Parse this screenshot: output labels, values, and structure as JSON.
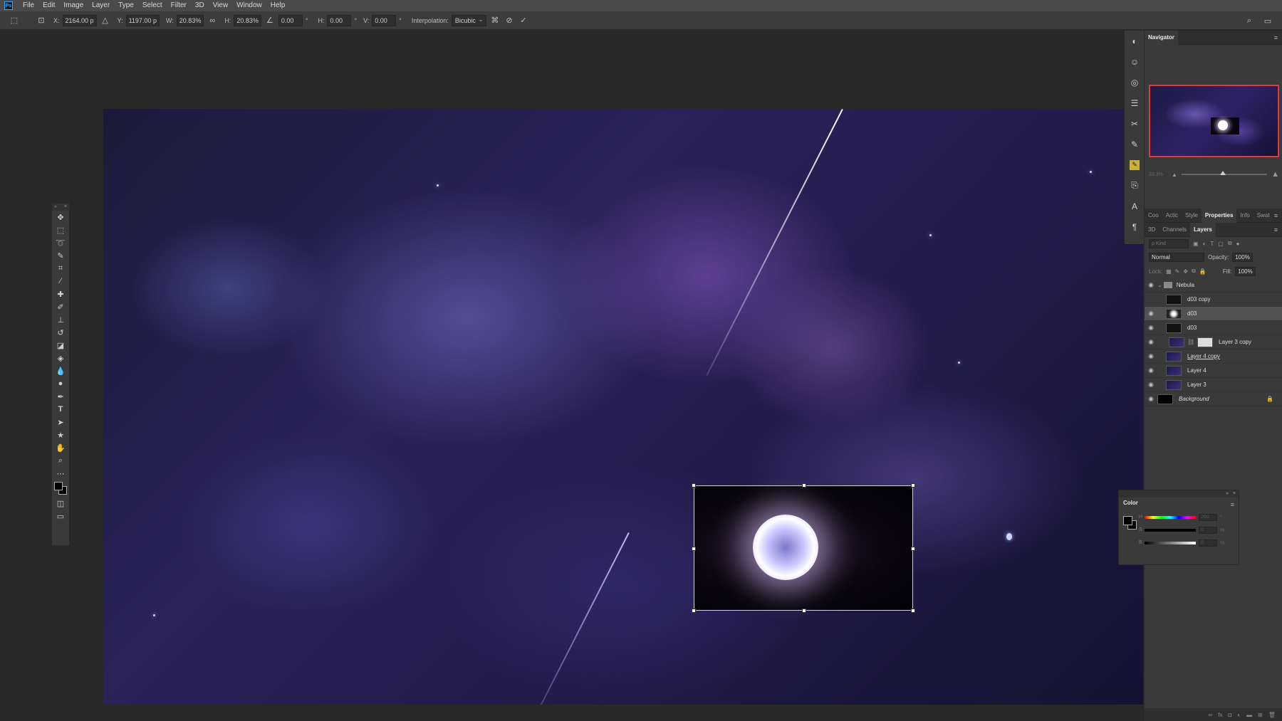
{
  "menubar": {
    "items": [
      "File",
      "Edit",
      "Image",
      "Layer",
      "Type",
      "Select",
      "Filter",
      "3D",
      "View",
      "Window",
      "Help"
    ]
  },
  "options": {
    "x_label": "X:",
    "x_value": "2164.00 p",
    "y_label": "Y:",
    "y_value": "1197.00 p",
    "w_label": "W:",
    "w_value": "20.83%",
    "h_label": "H:",
    "h_value": "20.83%",
    "angle_value": "0.00",
    "angle_unit": "°",
    "hskew_label": "H:",
    "hskew_value": "0.00",
    "vskew_label": "V:",
    "vskew_value": "0.00",
    "interpolation_label": "Interpolation:",
    "interpolation_value": "Bicubic"
  },
  "navigator": {
    "title": "Navigator",
    "zoom_text": "33.3%"
  },
  "properties_tabs": [
    "Coo",
    "Actic",
    "Style",
    "Properties",
    "Info",
    "Swat"
  ],
  "layers_tabs": [
    "3D",
    "Channels",
    "Layers"
  ],
  "layers": {
    "kind_placeholder": "ρ Kind",
    "blend_mode": "Normal",
    "opacity_label": "Opacity:",
    "opacity_value": "100%",
    "lock_label": "Lock:",
    "fill_label": "Fill:",
    "fill_value": "100%",
    "group_name": "Nebula",
    "rows": [
      {
        "name": "d03 copy"
      },
      {
        "name": "d03"
      },
      {
        "name": "d03"
      },
      {
        "name": "Layer 3 copy"
      },
      {
        "name": "Layer 4 copy"
      },
      {
        "name": "Layer 4"
      },
      {
        "name": "Layer 3"
      },
      {
        "name": "Background"
      }
    ]
  },
  "color_panel": {
    "title": "Color",
    "hue_value": "260",
    "sat_value": "0",
    "bri_value": "0",
    "unit_deg": "°",
    "unit_pct": "%",
    "labels": [
      "H",
      "S",
      "B"
    ]
  },
  "colors": {
    "accent_red": "#e03b3b",
    "panel_bg": "#3a3a3a",
    "canvas_nebula": "#2a2258"
  }
}
